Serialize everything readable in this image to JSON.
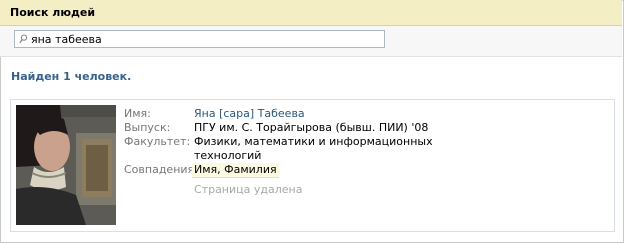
{
  "header": {
    "title": "Поиск людей"
  },
  "search": {
    "value": "яна табеева"
  },
  "results": {
    "found_text": "Найден 1 человек."
  },
  "person": {
    "labels": {
      "name": "Имя:",
      "graduation": "Выпуск:",
      "faculty": "Факультет:",
      "matches": "Совпадения:"
    },
    "name": "Яна [сара] Табеева",
    "graduation": "ПГУ им. С. Торайгырова (бывш. ПИИ) '08",
    "faculty_line1": "Физики, математики и информационных",
    "faculty_line2": "технологий",
    "matches": "Имя, Фамилия",
    "status": "Страница удалена"
  },
  "colors": {
    "header_bg": "#f4eec5",
    "link": "#2b587a",
    "found_text": "#36638e",
    "status_text": "#a8a8a8"
  }
}
